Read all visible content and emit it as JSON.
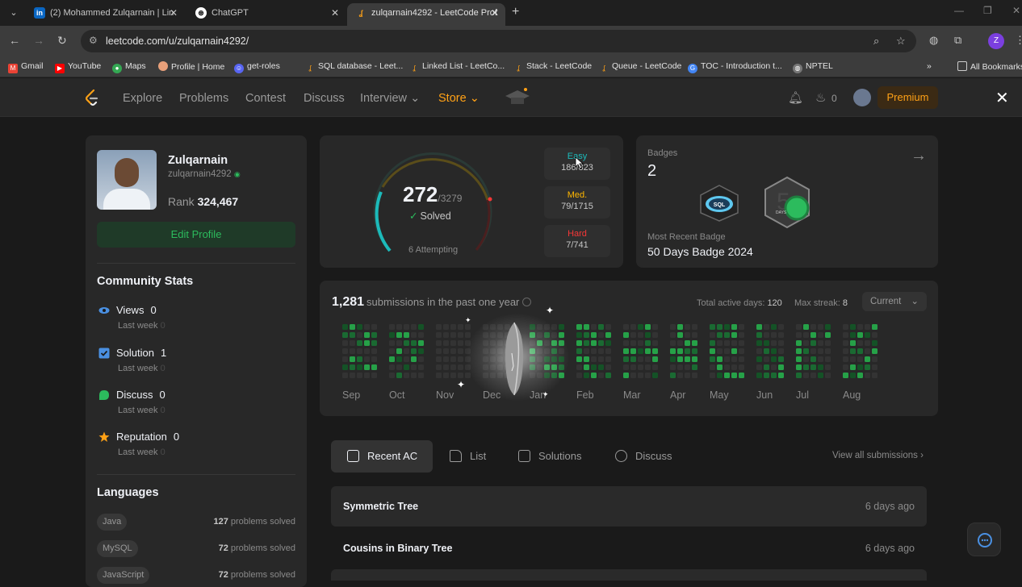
{
  "browser": {
    "tabs": [
      {
        "title": "(2) Mohammed Zulqarnain | Lin",
        "icon": "linkedin-icon",
        "close": "✕"
      },
      {
        "title": "ChatGPT",
        "icon": "chatgpt-icon",
        "close": "✕"
      },
      {
        "title": "zulqarnain4292 - LeetCode Prof",
        "icon": "leetcode-icon",
        "close": "✕"
      }
    ],
    "url": "leetcode.com/u/zulqarnain4292/",
    "profile_initial": "Z",
    "bookmarks": [
      "Gmail",
      "YouTube",
      "Maps",
      "Profile | Home",
      "get-roles",
      "SQL database - Leet...",
      "Linked List - LeetCo...",
      "Stack - LeetCode",
      "Queue - LeetCode",
      "TOC - Introduction t...",
      "NPTEL"
    ],
    "all_bookmarks": "All Bookmarks"
  },
  "nav": {
    "links": [
      "Explore",
      "Problems",
      "Contest",
      "Discuss",
      "Interview",
      "Store"
    ],
    "streak_count": "0",
    "premium": "Premium"
  },
  "profile": {
    "name": "Zulqarnain",
    "handle": "zulqarnain4292",
    "rank_label": "Rank",
    "rank_value": "324,467",
    "edit_label": "Edit Profile"
  },
  "community": {
    "title": "Community Stats",
    "stats": [
      {
        "label": "Views",
        "value": "0",
        "sub": "Last week",
        "sub_value": "0",
        "icon": "eye-icon"
      },
      {
        "label": "Solution",
        "value": "1",
        "sub": "Last week",
        "sub_value": "0",
        "icon": "check-square-icon"
      },
      {
        "label": "Discuss",
        "value": "0",
        "sub": "Last week",
        "sub_value": "0",
        "icon": "chat-icon"
      },
      {
        "label": "Reputation",
        "value": "0",
        "sub": "Last week",
        "sub_value": "0",
        "icon": "star-icon"
      }
    ]
  },
  "languages": {
    "title": "Languages",
    "items": [
      {
        "name": "Java",
        "count": "127",
        "suffix": "problems solved"
      },
      {
        "name": "MySQL",
        "count": "72",
        "suffix": "problems solved"
      },
      {
        "name": "JavaScript",
        "count": "72",
        "suffix": "problems solved"
      }
    ]
  },
  "solved": {
    "count": "272",
    "total": "/3279",
    "label": "Solved",
    "attempting": "6 Attempting",
    "difficulties": [
      {
        "name": "Easy",
        "value": "186/823",
        "color": "#1cbaba"
      },
      {
        "name": "Med.",
        "value": "79/1715",
        "color": "#ffb700"
      },
      {
        "name": "Hard",
        "value": "7/741",
        "color": "#f63737"
      }
    ]
  },
  "badges": {
    "label": "Badges",
    "count": "2",
    "recent_label": "Most Recent Badge",
    "recent_value": "50 Days Badge 2024",
    "sql_badge_text": "SQL",
    "days_badge_text": "DAYS"
  },
  "heatmap": {
    "count": "1,281",
    "title_suffix": "submissions in the past one year",
    "active_label": "Total active days:",
    "active_value": "120",
    "streak_label": "Max streak:",
    "streak_value": "8",
    "range": "Current",
    "months": [
      "Sep",
      "Oct",
      "Nov",
      "Dec",
      "Jan",
      "Feb",
      "Mar",
      "Apr",
      "May",
      "Jun",
      "Jul",
      "Aug"
    ]
  },
  "recent": {
    "tabs": [
      "Recent AC",
      "List",
      "Solutions",
      "Discuss"
    ],
    "view_all": "View all submissions",
    "rows": [
      {
        "name": "Symmetric Tree",
        "time": "6 days ago"
      },
      {
        "name": "Cousins in Binary Tree",
        "time": "6 days ago"
      }
    ]
  }
}
